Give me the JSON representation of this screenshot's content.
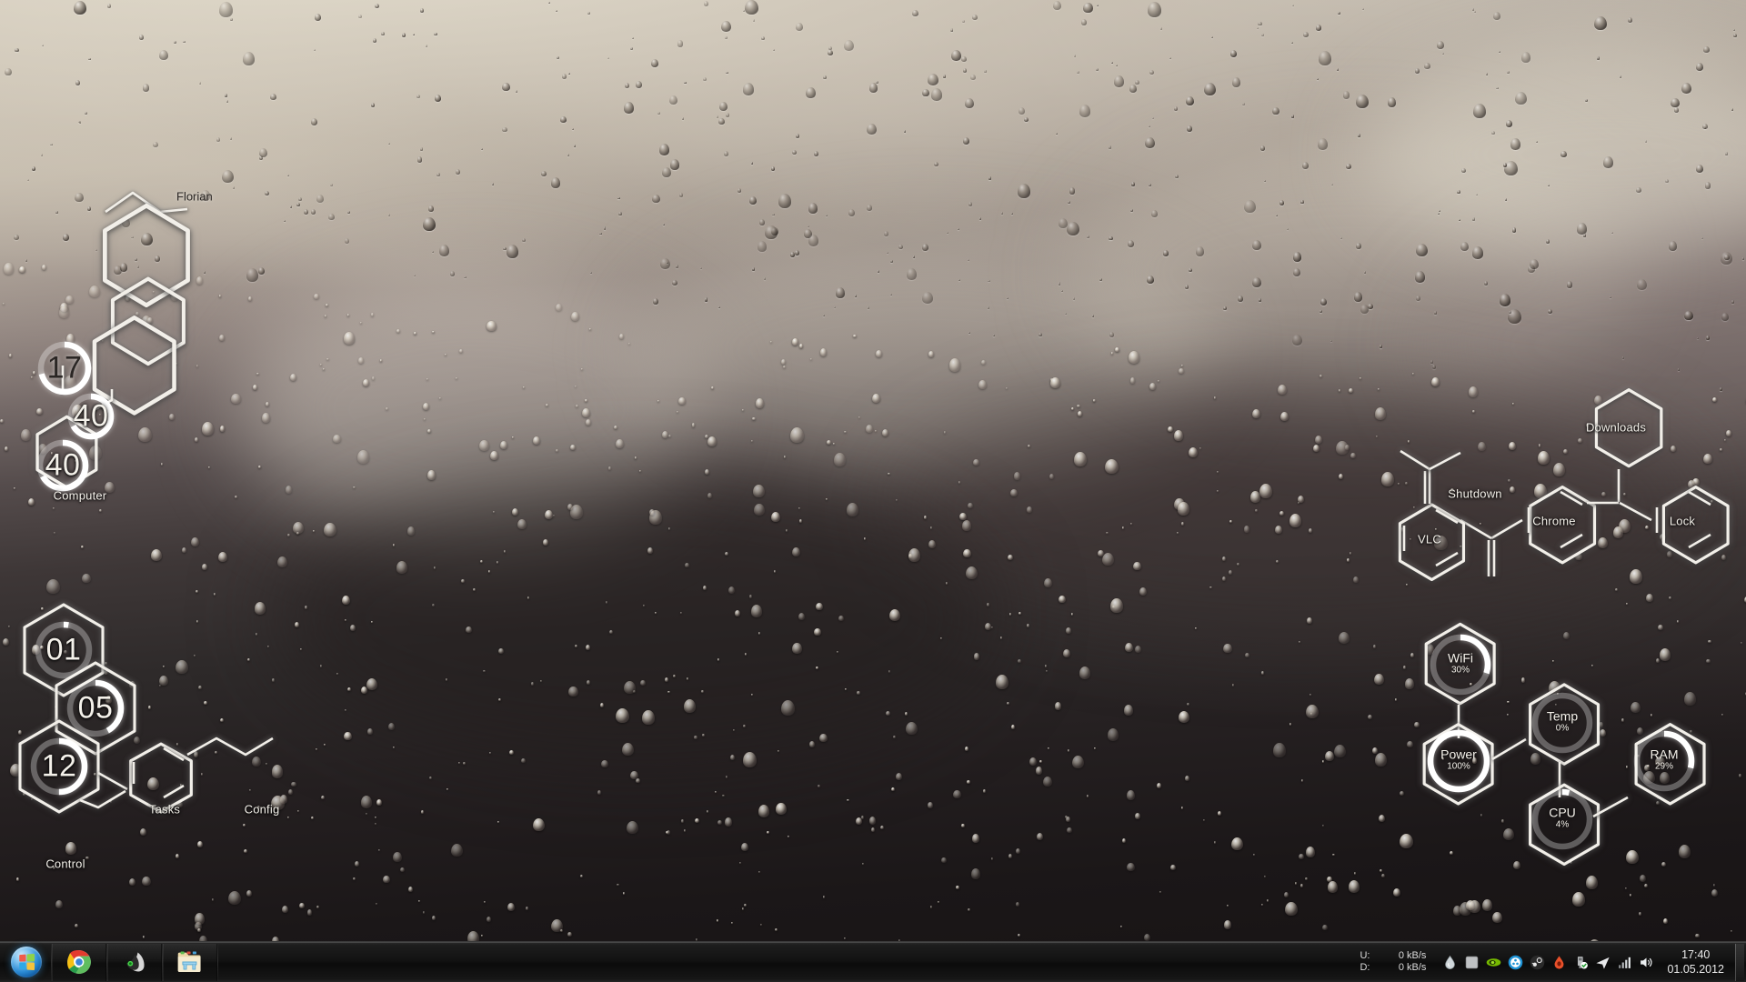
{
  "desktop": {
    "wallpaper_description": "rain droplets on window, sepia gradient",
    "colors": {
      "light": "#ddd6c7",
      "dark": "#171314",
      "line": "#f2efe9",
      "taskbar": "#121212"
    }
  },
  "clock_widget": {
    "user_label": "Florian",
    "hours": "17",
    "minutes": "40",
    "seconds": "40",
    "hours_pct": 71,
    "minutes_pct": 67,
    "seconds_pct": 67,
    "shortcut_label": "Computer"
  },
  "date_widget": {
    "day": "01",
    "month": "05",
    "year": "12",
    "day_pct": 3,
    "month_pct": 42,
    "year_pct": 50,
    "labels": {
      "control": "Control",
      "tasks": "Tasks",
      "config": "Config"
    }
  },
  "launcher": {
    "downloads": "Downloads",
    "chrome": "Chrome",
    "lock": "Lock",
    "shutdown": "Shutdown",
    "vlc": "VLC"
  },
  "monitors": [
    {
      "name": "WiFi",
      "value": "30%",
      "pct": 30
    },
    {
      "name": "Temp",
      "value": "0%",
      "pct": 0
    },
    {
      "name": "Power",
      "value": "100%",
      "pct": 100
    },
    {
      "name": "CPU",
      "value": "4%",
      "pct": 4
    },
    {
      "name": "RAM",
      "value": "29%",
      "pct": 29
    }
  ],
  "taskbar": {
    "start_tooltip": "Start",
    "buttons": [
      {
        "icon": "chrome-icon",
        "label": "Google Chrome"
      },
      {
        "icon": "vlc-icon",
        "label": "VLC media player"
      },
      {
        "icon": "explorer-icon",
        "label": "Windows Explorer"
      }
    ],
    "network": {
      "upload_label": "U:",
      "download_label": "D:",
      "upload_value": "0 kB/s",
      "download_value": "0 kB/s"
    },
    "tray_icons": [
      "rainmeter-icon",
      "square-app-icon",
      "nvidia-icon",
      "daemon-tools-icon",
      "steam-icon",
      "red-drop-icon",
      "usb-safely-remove-icon",
      "teamviewer-icon",
      "network-signal-icon",
      "volume-icon"
    ],
    "clock": {
      "time": "17:40",
      "date": "01.05.2012"
    }
  }
}
